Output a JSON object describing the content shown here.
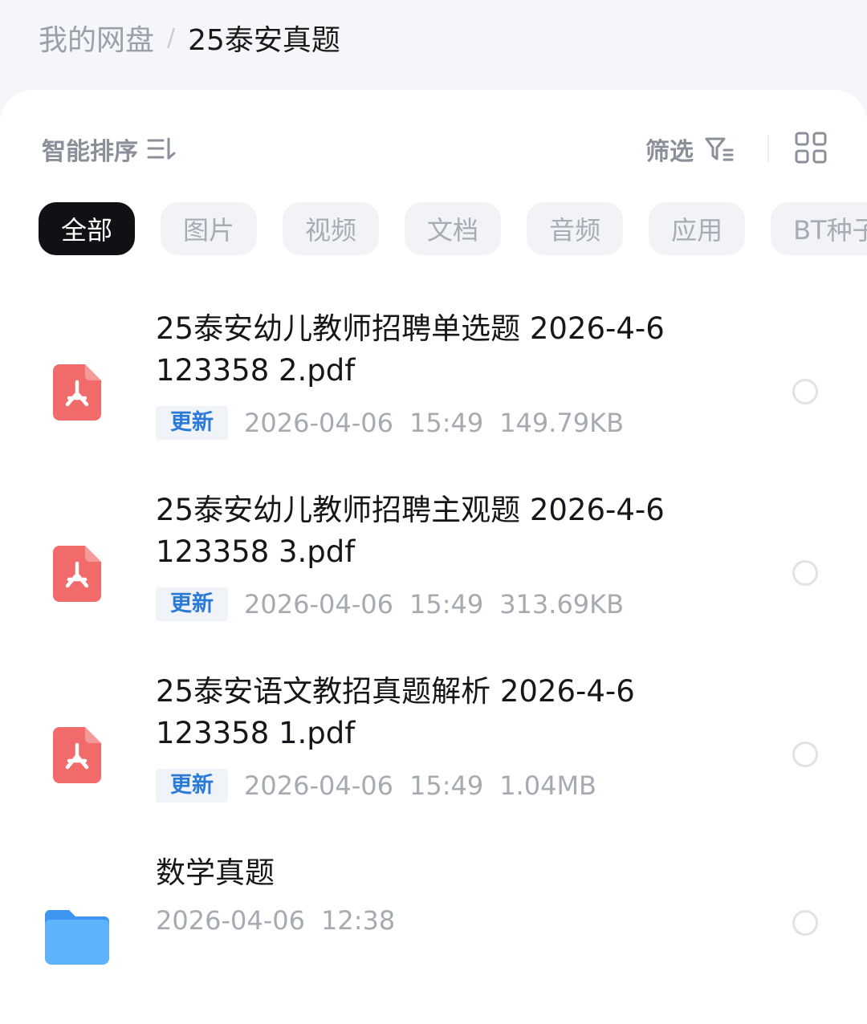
{
  "breadcrumb": {
    "root": "我的网盘",
    "separator": "/",
    "current": "25泰安真题"
  },
  "toolbar": {
    "sort_label": "智能排序",
    "sort_icon": "sort-icon",
    "filter_label": "筛选",
    "filter_icon": "filter-icon",
    "view_icon": "grid-view-icon"
  },
  "chips": [
    {
      "label": "全部",
      "active": true
    },
    {
      "label": "图片",
      "active": false
    },
    {
      "label": "视频",
      "active": false
    },
    {
      "label": "文档",
      "active": false
    },
    {
      "label": "音频",
      "active": false
    },
    {
      "label": "应用",
      "active": false
    },
    {
      "label": "BT种子",
      "active": false
    }
  ],
  "files": [
    {
      "icon": "pdf-icon",
      "name_line1": "25泰安幼儿教师招聘单选题 2026-4-6",
      "name_line2": "123358 2.pdf",
      "badge": "更新",
      "date": "2026-04-06",
      "time": "15:49",
      "size": "149.79KB"
    },
    {
      "icon": "pdf-icon",
      "name_line1": "25泰安幼儿教师招聘主观题 2026-4-6",
      "name_line2": "123358 3.pdf",
      "badge": "更新",
      "date": "2026-04-06",
      "time": "15:49",
      "size": "313.69KB"
    },
    {
      "icon": "pdf-icon",
      "name_line1": "25泰安语文教招真题解析 2026-4-6",
      "name_line2": "123358 1.pdf",
      "badge": "更新",
      "date": "2026-04-06",
      "time": "15:49",
      "size": "1.04MB"
    }
  ],
  "folders": [
    {
      "icon": "folder-icon",
      "name": "数学真题",
      "date": "2026-04-06",
      "time": "12:38"
    }
  ],
  "colors": {
    "pdf": "#f26b6b",
    "folder": "#4aa3f5",
    "badge_text": "#2b7ad8",
    "active_chip": "#0f1114"
  }
}
